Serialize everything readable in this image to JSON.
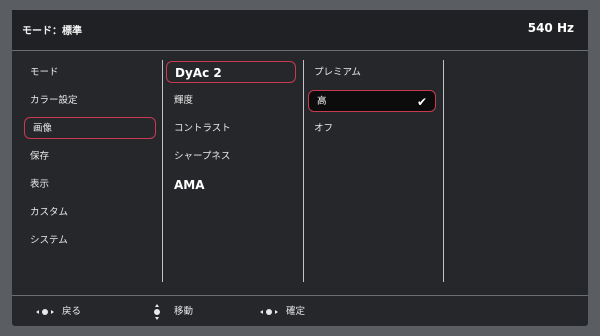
{
  "header": {
    "title": "モード：標準",
    "refresh": "540 Hz"
  },
  "menu": {
    "col1": [
      "モード",
      "カラー設定",
      "画像",
      "保存",
      "表示",
      "カスタム",
      "システム"
    ],
    "col2": [
      "DyAc 2",
      "輝度",
      "コントラスト",
      "シャープネス",
      "AMA"
    ],
    "col3": [
      "プレミアム",
      "高",
      "オフ"
    ]
  },
  "footer": {
    "back": "戻る",
    "move": "移動",
    "confirm": "確定"
  },
  "colors": {
    "accent": "#c83a52",
    "background": "#25272b"
  },
  "icons": {
    "check": "✔"
  }
}
